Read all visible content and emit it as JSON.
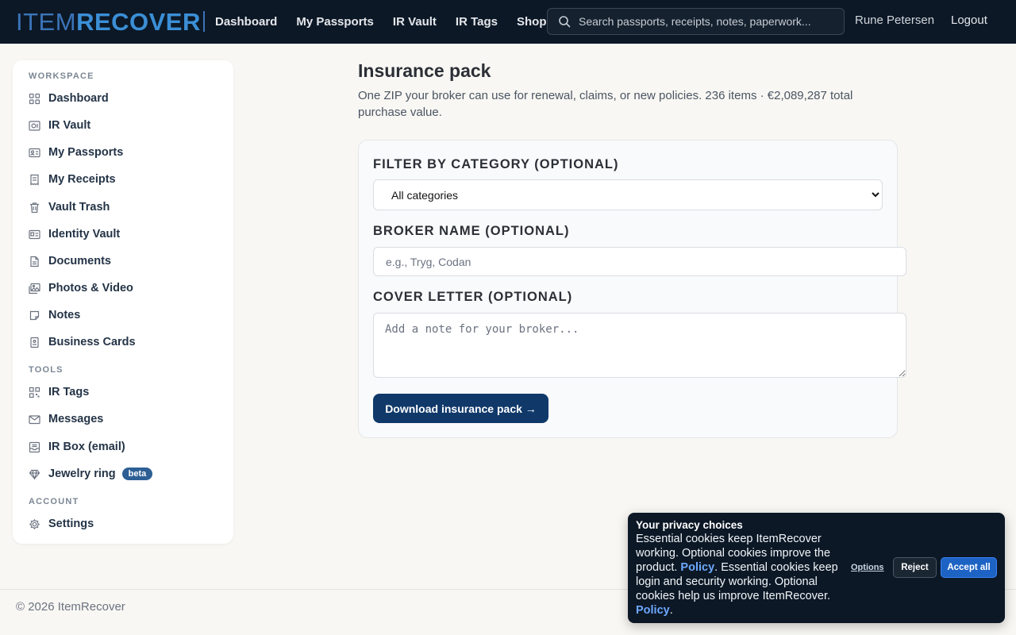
{
  "header": {
    "logo_part1": "ITEM",
    "logo_part2": "RECOVER",
    "nav": [
      "Dashboard",
      "My Passports",
      "IR Vault",
      "IR Tags",
      "Shop"
    ],
    "search_placeholder": "Search passports, receipts, notes, paperwork...",
    "user_name": "Rune Petersen",
    "logout_label": "Logout"
  },
  "sidebar": {
    "workspace_title": "WORKSPACE",
    "workspace_items": [
      {
        "label": "Dashboard",
        "icon": "grid-icon"
      },
      {
        "label": "IR Vault",
        "icon": "vault-icon"
      },
      {
        "label": "My Passports",
        "icon": "id-card-icon"
      },
      {
        "label": "My Receipts",
        "icon": "receipt-icon"
      },
      {
        "label": "Vault Trash",
        "icon": "trash-icon"
      },
      {
        "label": "Identity Vault",
        "icon": "identity-icon"
      },
      {
        "label": "Documents",
        "icon": "document-icon"
      },
      {
        "label": "Photos & Video",
        "icon": "photos-icon"
      },
      {
        "label": "Notes",
        "icon": "note-icon"
      },
      {
        "label": "Business Cards",
        "icon": "business-card-icon"
      }
    ],
    "tools_title": "TOOLS",
    "tools_items": [
      {
        "label": "IR Tags",
        "icon": "qr-icon"
      },
      {
        "label": "Messages",
        "icon": "mail-icon"
      },
      {
        "label": "IR Box (email)",
        "icon": "inbox-icon"
      },
      {
        "label": "Jewelry ring",
        "icon": "diamond-icon",
        "badge": "beta"
      }
    ],
    "account_title": "ACCOUNT",
    "account_items": [
      {
        "label": "Settings",
        "icon": "gear-icon"
      }
    ]
  },
  "main": {
    "title": "Insurance pack",
    "description": "One ZIP your broker can use for renewal, claims, or new policies. 236 items · €2,089,287 total purchase value.",
    "filter_label": "FILTER BY CATEGORY (OPTIONAL)",
    "filter_selected": "All categories",
    "broker_label": "BROKER NAME (OPTIONAL)",
    "broker_placeholder": "e.g., Tryg, Codan",
    "cover_label": "COVER LETTER (OPTIONAL)",
    "cover_placeholder": "Add a note for your broker...",
    "download_label": "Download insurance pack →"
  },
  "footer": {
    "copyright": "© 2026 ItemRecover"
  },
  "cookie": {
    "title": "Your privacy choices",
    "text1": "Essential cookies keep ItemRecover working. Optional cookies improve the product. ",
    "link1": "Policy",
    "text2": ". Essential cookies keep login and security working. Optional cookies help us improve ItemRecover. ",
    "link2": "Policy",
    "text3": ".",
    "options_label": "Options",
    "reject_label": "Reject",
    "accept_label": "Accept all"
  },
  "colors": {
    "topbar": "#0c1826",
    "accent": "#10396a",
    "badge": "#2d5f95",
    "link": "#6ea8ff"
  }
}
